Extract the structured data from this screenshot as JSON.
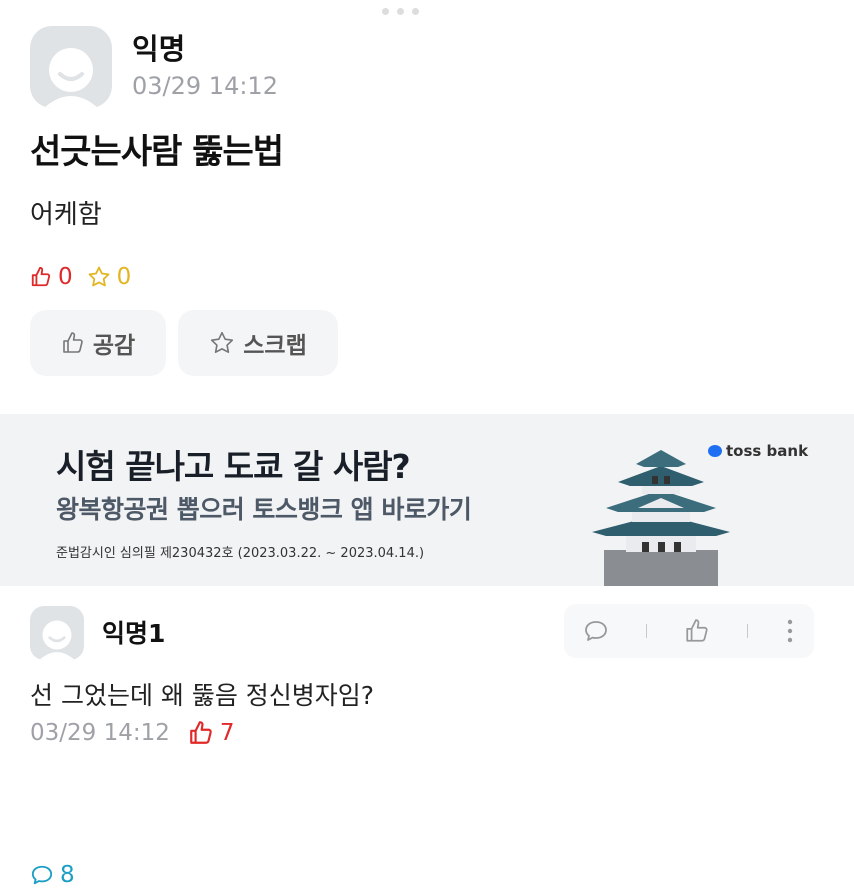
{
  "post": {
    "author": "익명",
    "timestamp": "03/29 14:12",
    "title": "선긋는사람 뚫는법",
    "body": "어케함",
    "stats": {
      "likes": "0",
      "comments": "8",
      "scraps": "0"
    },
    "actions": {
      "like_label": "공감",
      "scrap_label": "스크랩"
    }
  },
  "ad": {
    "headline": "시험 끝나고 도쿄 갈 사람?",
    "subline": "왕복항공권 뽑으러 토스뱅크 앱 바로가기",
    "note": "준법감시인 심의필 제230432호 (2023.03.22. ~ 2023.04.14.)",
    "brand": "toss bank"
  },
  "comment": {
    "author": "익명1",
    "text": "선 그었는데 왜 뚫음 정신병자임?",
    "timestamp": "03/29 14:12",
    "likes": "7"
  },
  "icons": {
    "like": "thumbs-up-icon",
    "comment": "speech-bubble-icon",
    "scrap": "star-icon",
    "more": "more-vertical-icon"
  },
  "colors": {
    "like": "#e02a2a",
    "comment": "#1d9fc4",
    "scrap": "#e3b521",
    "muted": "#9ea2a7"
  }
}
